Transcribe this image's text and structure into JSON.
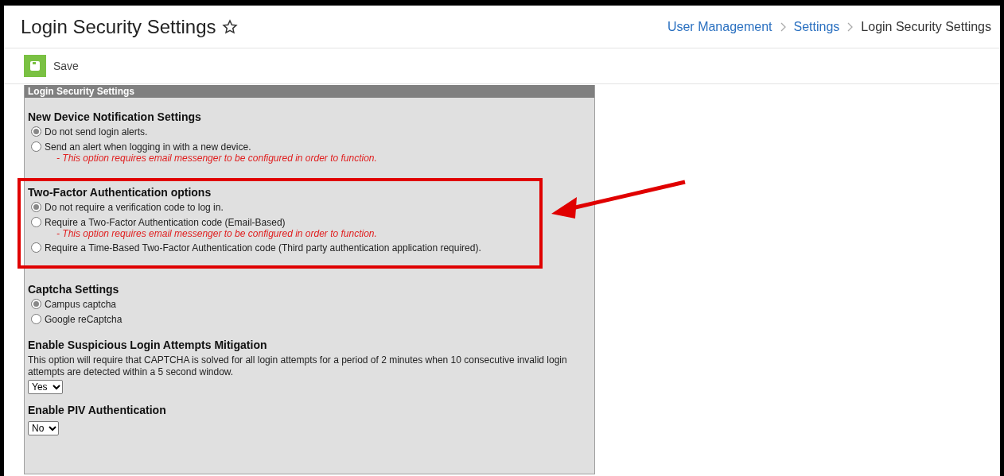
{
  "page": {
    "title": "Login Security Settings",
    "favorite": false
  },
  "breadcrumb": [
    {
      "label": "User Management",
      "link": true
    },
    {
      "label": "Settings",
      "link": true
    },
    {
      "label": "Login Security Settings",
      "link": false
    }
  ],
  "toolbar": {
    "save": "Save"
  },
  "panel": {
    "title": "Login Security Settings",
    "sections": [
      {
        "kind": "radio",
        "heading": "New Device Notification Settings",
        "highlighted": false,
        "options": [
          {
            "label": "Do not send login alerts.",
            "selected": true
          },
          {
            "label": "Send an alert when logging in with a new device.",
            "note": "- This option requires email messenger to be configured in order to function.",
            "selected": false
          }
        ]
      },
      {
        "kind": "radio",
        "heading": "Two-Factor Authentication options",
        "highlighted": true,
        "options": [
          {
            "label": "Do not require a verification code to log in.",
            "selected": true
          },
          {
            "label": "Require a Two-Factor Authentication code (Email-Based)",
            "note": "- This option requires email messenger to be configured in order to function.",
            "selected": false
          },
          {
            "label": "Require a Time-Based Two-Factor Authentication code (Third party authentication application required).",
            "selected": false
          }
        ]
      },
      {
        "kind": "radio",
        "heading": "Captcha Settings",
        "highlighted": false,
        "options": [
          {
            "label": "Campus captcha",
            "selected": true
          },
          {
            "label": "Google reCaptcha",
            "selected": false
          }
        ]
      },
      {
        "kind": "select",
        "heading": "Enable Suspicious Login Attempts Mitigation",
        "highlighted": false,
        "description": "This option will require that CAPTCHA is solved for all login attempts for a period of 2 minutes when 10 consecutive invalid login attempts are detected within a 5 second window.",
        "value": "Yes"
      },
      {
        "kind": "select",
        "heading": "Enable PIV Authentication",
        "highlighted": false,
        "value": "No"
      }
    ]
  }
}
